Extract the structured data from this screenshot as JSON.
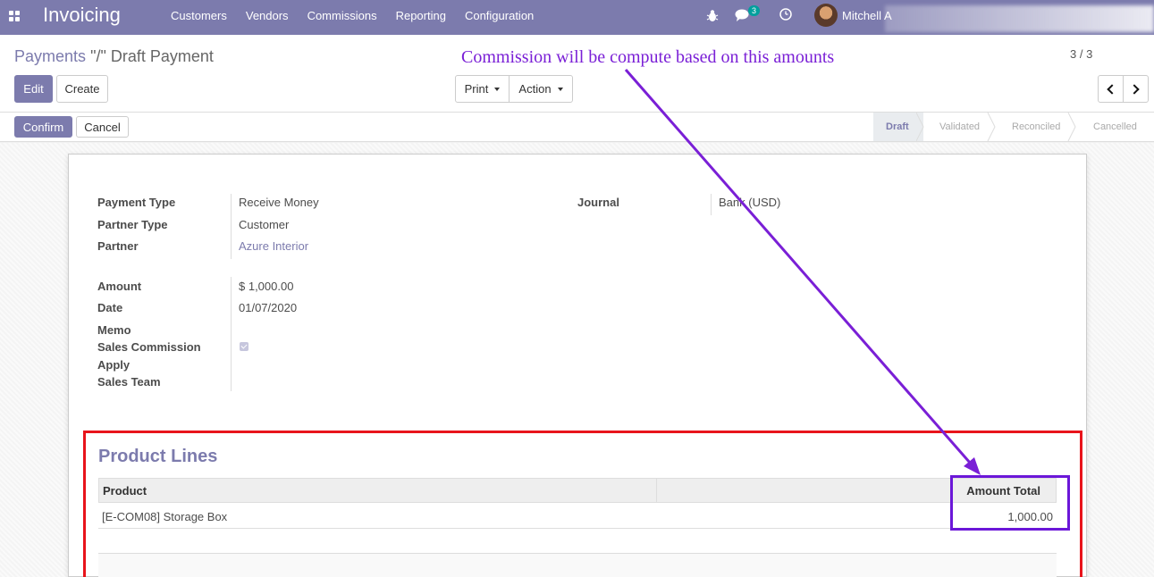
{
  "navbar": {
    "app_title": "Invoicing",
    "menu": [
      "Customers",
      "Vendors",
      "Commissions",
      "Reporting",
      "Configuration"
    ],
    "messages_count": "3",
    "user_name": "Mitchell A"
  },
  "control": {
    "breadcrumb_link": "Payments",
    "breadcrumb_current": "\"/\" Draft Payment",
    "edit_label": "Edit",
    "create_label": "Create",
    "print_label": "Print",
    "action_label": "Action",
    "pager": "3 / 3"
  },
  "statusbar": {
    "confirm_label": "Confirm",
    "cancel_label": "Cancel",
    "stages": [
      "Draft",
      "Validated",
      "Reconciled",
      "Cancelled"
    ],
    "active_stage": "Draft"
  },
  "form": {
    "payment_type_label": "Payment Type",
    "payment_type": "Receive Money",
    "partner_type_label": "Partner Type",
    "partner_type": "Customer",
    "partner_label": "Partner",
    "partner": "Azure Interior",
    "journal_label": "Journal",
    "journal": "Bank (USD)",
    "amount_label": "Amount",
    "amount": "$ 1,000.00",
    "date_label": "Date",
    "date": "01/07/2020",
    "memo_label": "Memo",
    "sales_commission_label": "Sales Commission",
    "apply_label": "Apply",
    "sales_team_label": "Sales Team"
  },
  "product_lines": {
    "title": "Product Lines",
    "columns": [
      "Product",
      "Amount Total"
    ],
    "rows": [
      {
        "product": "[E-COM08] Storage Box",
        "amount_total": "1,000.00"
      }
    ]
  },
  "annotation": {
    "text": "Commission will be compute based on this amounts",
    "text_color": "#7a1fd6",
    "highlight_color": "#e8141b"
  }
}
